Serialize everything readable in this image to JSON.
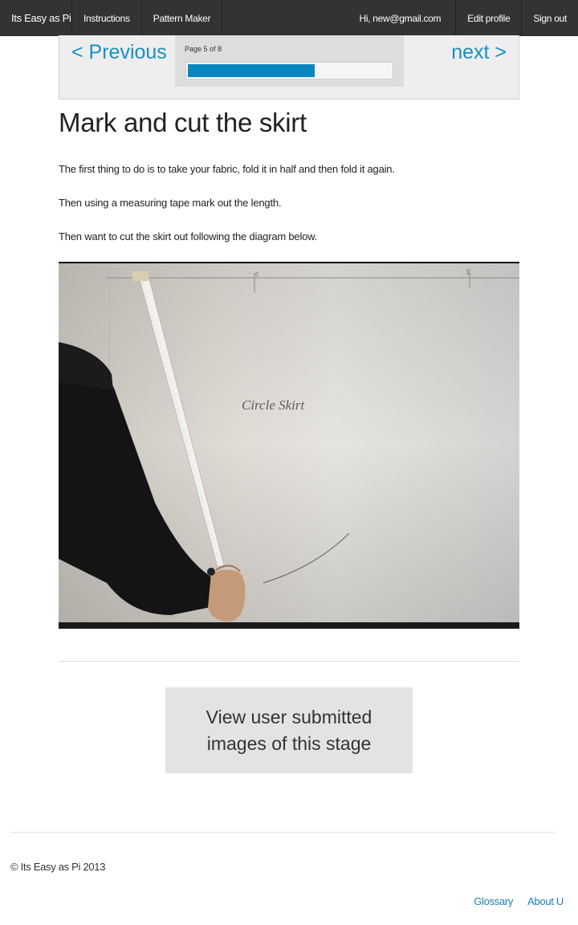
{
  "nav": {
    "brand": "Its Easy as Pi",
    "instructions": "Instructions",
    "pattern_maker": "Pattern Maker",
    "greeting": "Hi, new@gmail.com",
    "edit_profile": "Edit profile",
    "sign_out": "Sign out"
  },
  "pager": {
    "previous": "< Previous",
    "next": "next >",
    "page_label": "Page 5 of 8",
    "current_page": 5,
    "total_pages": 8,
    "progress_fraction": 0.625
  },
  "content": {
    "title": "Mark and cut the skirt",
    "paragraphs": [
      "The first thing to do is to take your fabric, fold it in half and then fold it again.",
      "Then using a measuring tape mark out the length.",
      "Then want to cut the skirt out following the diagram below."
    ],
    "image_handwriting": "Circle Skirt"
  },
  "submitted_button": "View user submitted images of this stage",
  "footer": {
    "copyright": "© Its Easy as Pi 2013",
    "links": [
      "Glossary",
      "About U"
    ]
  },
  "colors": {
    "nav_bg": "#333333",
    "link": "#1a8ec4",
    "progress": "#0a87be"
  }
}
